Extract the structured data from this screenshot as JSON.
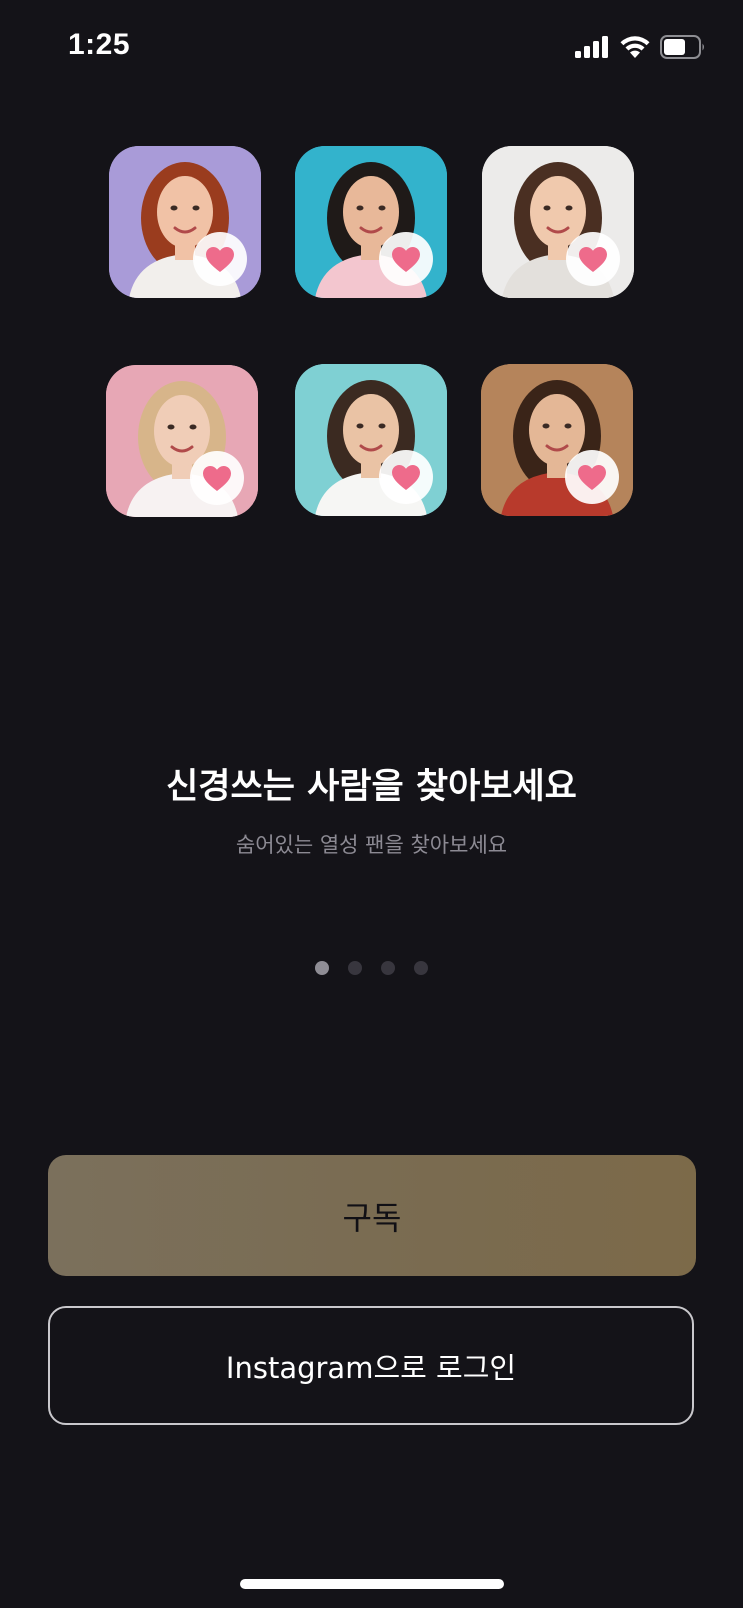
{
  "status_bar": {
    "time": "1:25",
    "icons": [
      "signal-icon",
      "wifi-icon",
      "battery-icon"
    ]
  },
  "photos": [
    {
      "name": "profile-photo-1",
      "bg": "#a99bd8",
      "hair": "#9a3c1e",
      "skin": "#f1c2a6",
      "shirt": "#f2efec"
    },
    {
      "name": "profile-photo-2",
      "bg": "#33b3cc",
      "hair": "#1f1a18",
      "skin": "#e8b899",
      "shirt": "#f3c6cf"
    },
    {
      "name": "profile-photo-3",
      "bg": "#ecebea",
      "hair": "#4a2f22",
      "skin": "#f0c9ad",
      "shirt": "#e3e0dc"
    },
    {
      "name": "profile-photo-4",
      "bg": "#e7a7b5",
      "hair": "#d7b58a",
      "skin": "#f0cdb7",
      "shirt": "#f7f2f2"
    },
    {
      "name": "profile-photo-5",
      "bg": "#7fd0d3",
      "hair": "#3b2a21",
      "skin": "#eac3a5",
      "shirt": "#f6f6f4"
    },
    {
      "name": "profile-photo-6",
      "bg": "#b5845b",
      "hair": "#3a2418",
      "skin": "#e4b796",
      "shirt": "#b83a2c"
    }
  ],
  "heart_color": "#ee6b8b",
  "onboarding": {
    "title": "신경쓰는 사람을 찾아보세요",
    "subtitle": "숨어있는 열성 팬을 찾아보세요",
    "page_count": 4,
    "active_page": 1
  },
  "buttons": {
    "subscribe": "구독",
    "instagram_login": "Instagram으로 로그인"
  },
  "colors": {
    "background": "#141318",
    "subscribe_gradient": [
      "#7b705c",
      "#7c6a49"
    ]
  }
}
